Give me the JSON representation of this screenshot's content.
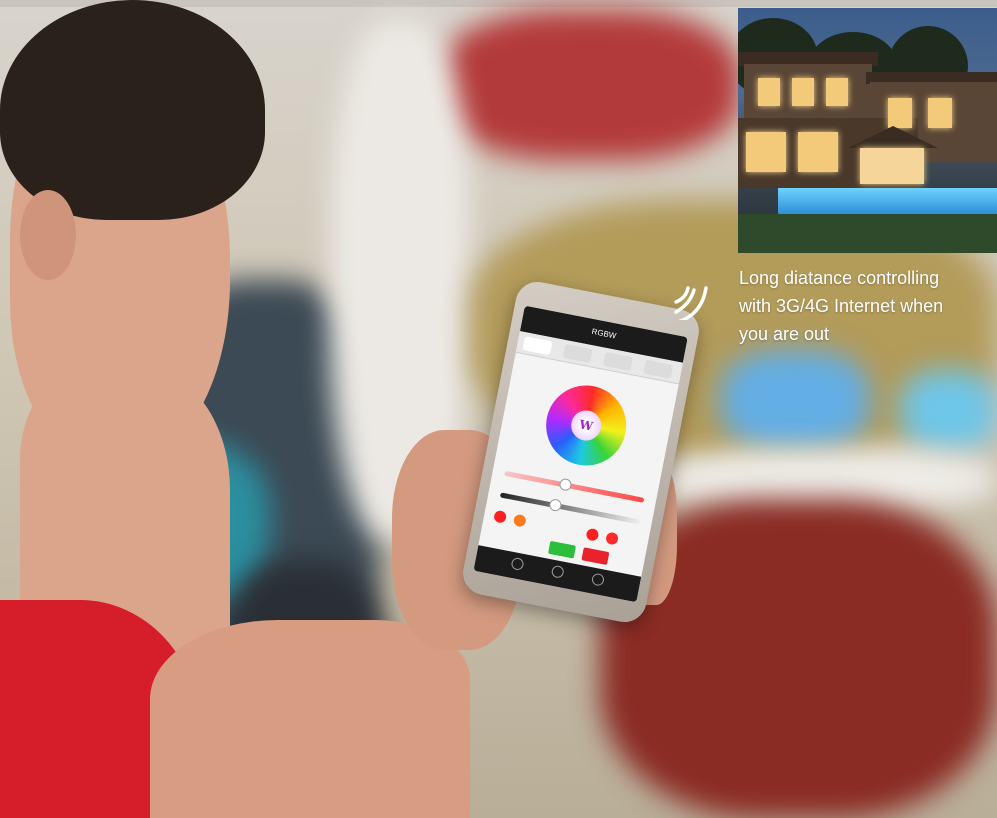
{
  "caption": {
    "line1": "Long diatance controlling",
    "line2": "with 3G/4G Internet when",
    "line3": "you are out"
  },
  "phone_app": {
    "title": "RGBW"
  },
  "colors": {
    "shirt": "#d61e2a",
    "caption_text": "#ffffff",
    "on_button": "#2bbf3c",
    "off_button": "#e8232b"
  },
  "icons": {
    "signal": "wireless-signal-icon",
    "wheel_center": "w-logo-icon"
  }
}
